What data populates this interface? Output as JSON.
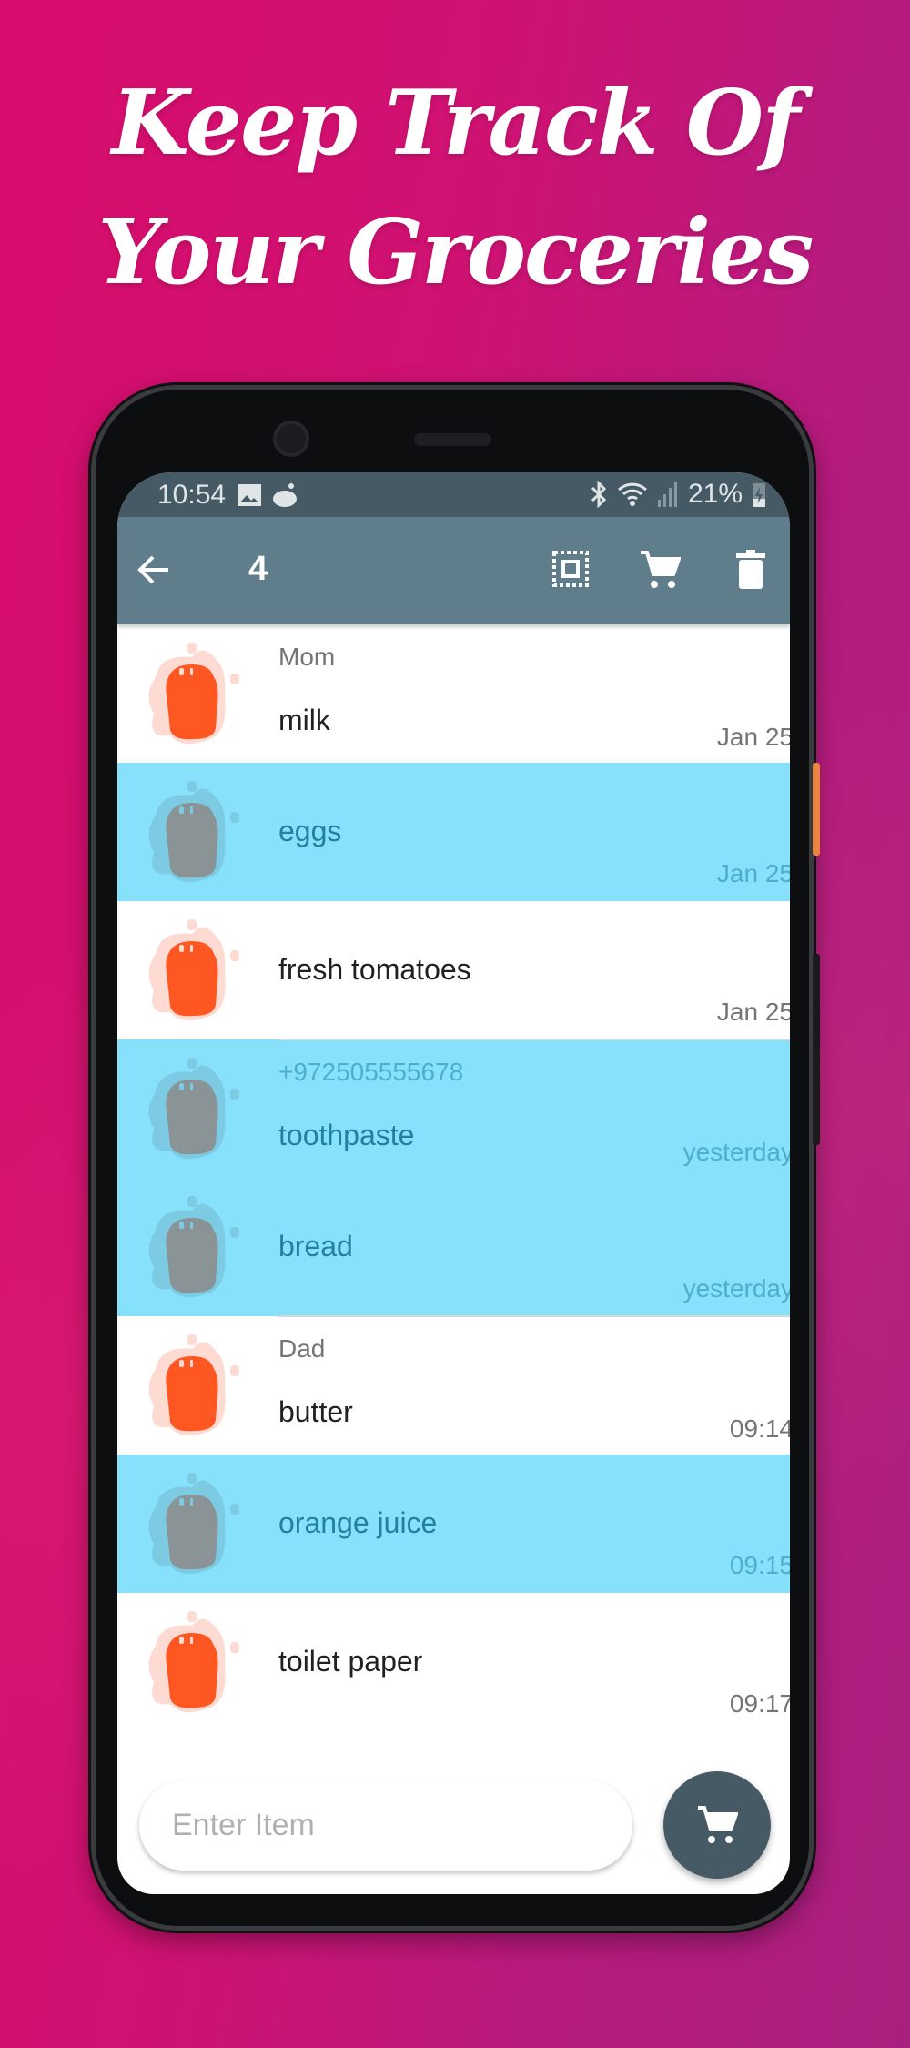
{
  "headline": {
    "line1": "Keep Track Of",
    "line2": "Your Groceries"
  },
  "status_bar": {
    "time": "10:54",
    "battery": "21%"
  },
  "toolbar": {
    "selected_count": "4",
    "icons": [
      "arrow-back-icon",
      "select-all-icon",
      "cart-icon",
      "trash-icon"
    ]
  },
  "items": [
    {
      "sender": "Mom",
      "name": "milk",
      "date": "Jan 25",
      "selected": false
    },
    {
      "sender": "",
      "name": "eggs",
      "date": "Jan 25",
      "selected": true
    },
    {
      "sender": "",
      "name": "fresh tomatoes",
      "date": "Jan 25",
      "selected": false
    },
    {
      "sender": "+972505555678",
      "name": "toothpaste",
      "date": "yesterday",
      "selected": true
    },
    {
      "sender": "",
      "name": "bread",
      "date": "yesterday",
      "selected": true
    },
    {
      "sender": "Dad",
      "name": "butter",
      "date": "09:14",
      "selected": false
    },
    {
      "sender": "",
      "name": "orange juice",
      "date": "09:15",
      "selected": true
    },
    {
      "sender": "",
      "name": "toilet paper",
      "date": "09:17",
      "selected": false
    }
  ],
  "input": {
    "placeholder": "Enter Item",
    "value": ""
  },
  "colors": {
    "toolbar": "#607d8b",
    "status": "#455a64",
    "selected_row": "#87e1fa",
    "avatar": "#ff5722"
  }
}
